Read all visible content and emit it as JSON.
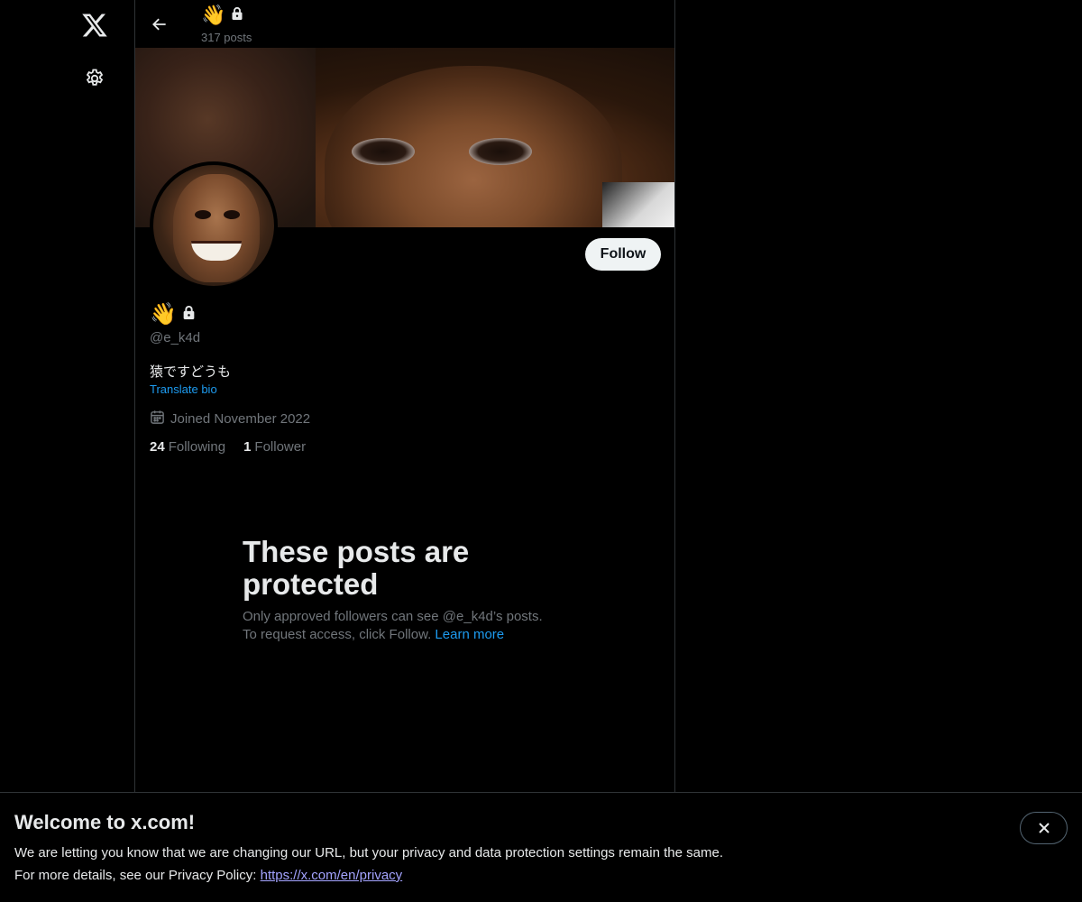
{
  "sidebar": {
    "logo_icon": "x-logo-icon",
    "settings_icon": "gear-icon"
  },
  "header": {
    "name_emoji": "👋",
    "posts_count": "317 posts"
  },
  "profile": {
    "name_emoji": "👋",
    "handle": "@e_k4d",
    "bio": "猿ですどうも",
    "translate_label": "Translate bio",
    "joined": "Joined November 2022",
    "following_count": "24",
    "following_label": "Following",
    "followers_count": "1",
    "followers_label": "Follower",
    "follow_button": "Follow"
  },
  "protected": {
    "title": "These posts are protected",
    "line1": "Only approved followers can see @e_k4d’s posts.",
    "line2": "To request access, click Follow.",
    "learn_more": "Learn more"
  },
  "notice": {
    "title": "Welcome to x.com!",
    "line1": "We are letting you know that we are changing our URL, but your privacy and data protection settings remain the same.",
    "line2_prefix": "For more details, see our Privacy Policy:",
    "link": "https://x.com/en/privacy"
  },
  "colors": {
    "background": "#000000",
    "accent": "#1d9bf0",
    "muted": "#71767b",
    "border": "#2f3336"
  }
}
